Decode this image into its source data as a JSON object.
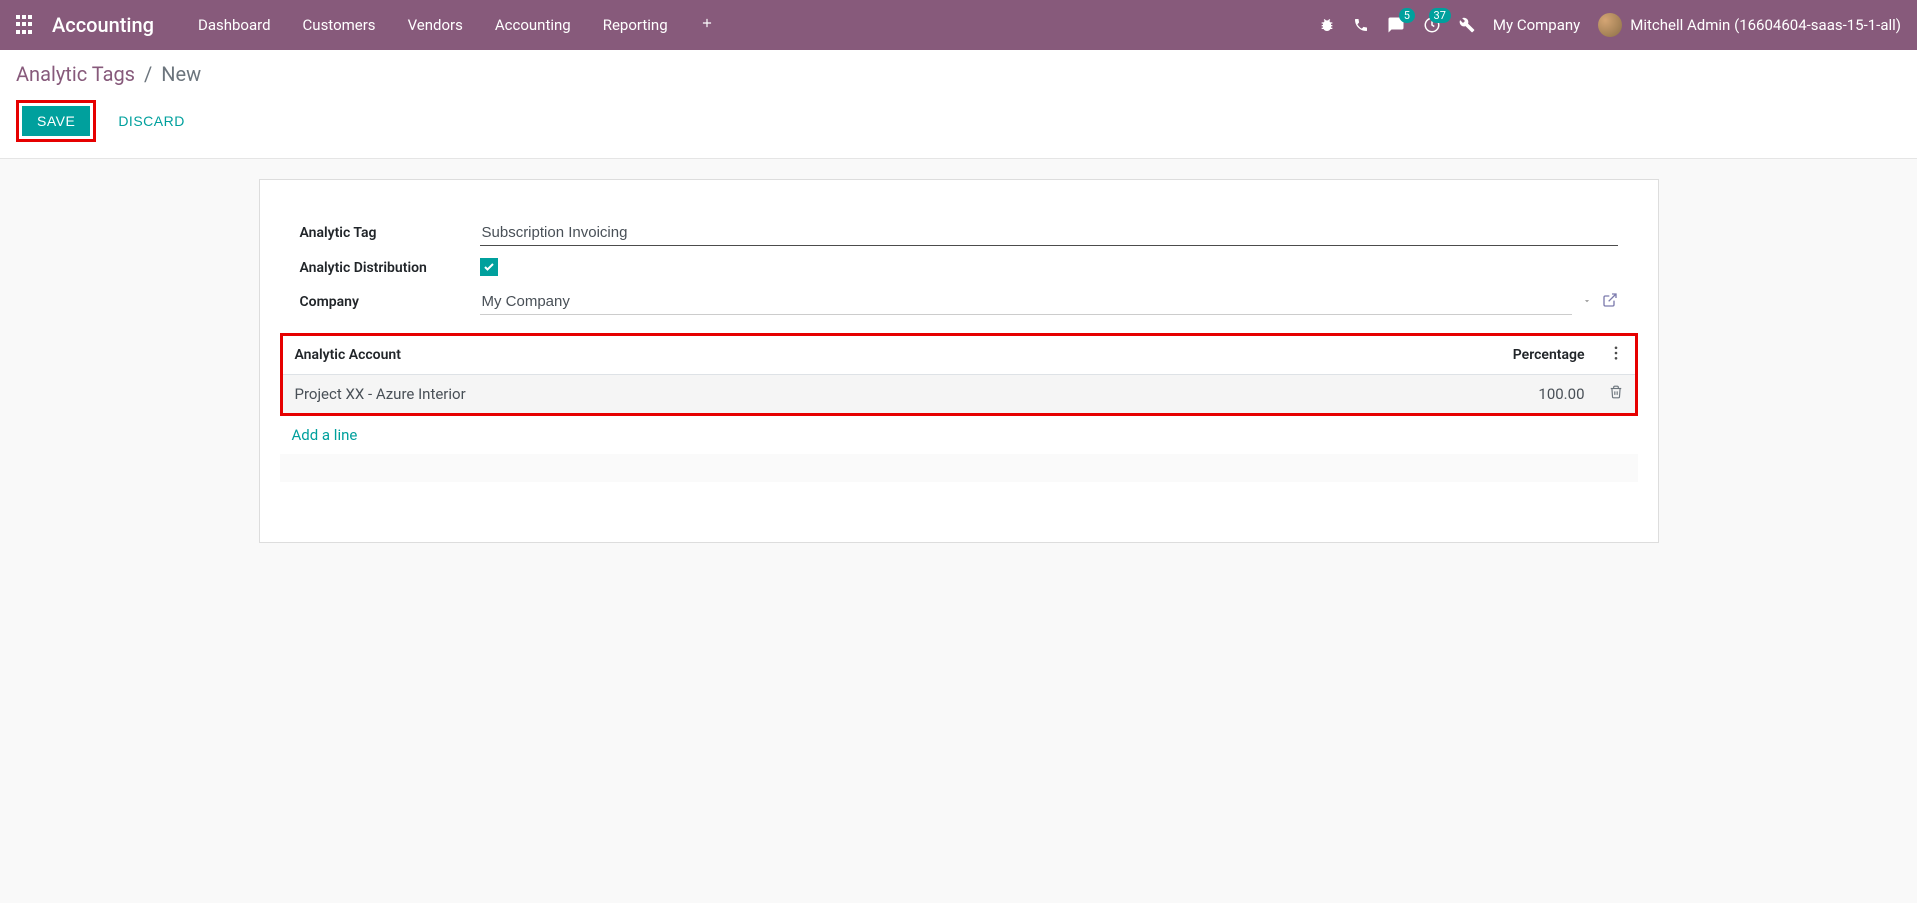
{
  "navbar": {
    "brand": "Accounting",
    "menu": [
      "Dashboard",
      "Customers",
      "Vendors",
      "Accounting",
      "Reporting"
    ],
    "messages_badge": "5",
    "activities_badge": "37",
    "company": "My Company",
    "user_name": "Mitchell Admin (16604604-saas-15-1-all)"
  },
  "breadcrumb": {
    "parent": "Analytic Tags",
    "current": "New"
  },
  "buttons": {
    "save": "SAVE",
    "discard": "DISCARD"
  },
  "form": {
    "labels": {
      "tag": "Analytic Tag",
      "distribution": "Analytic Distribution",
      "company": "Company"
    },
    "values": {
      "tag": "Subscription Invoicing",
      "distribution_checked": true,
      "company": "My Company"
    }
  },
  "table": {
    "headers": {
      "account": "Analytic Account",
      "percentage": "Percentage"
    },
    "rows": [
      {
        "account": "Project XX - Azure Interior",
        "percentage": "100.00"
      }
    ],
    "add_line": "Add a line"
  }
}
